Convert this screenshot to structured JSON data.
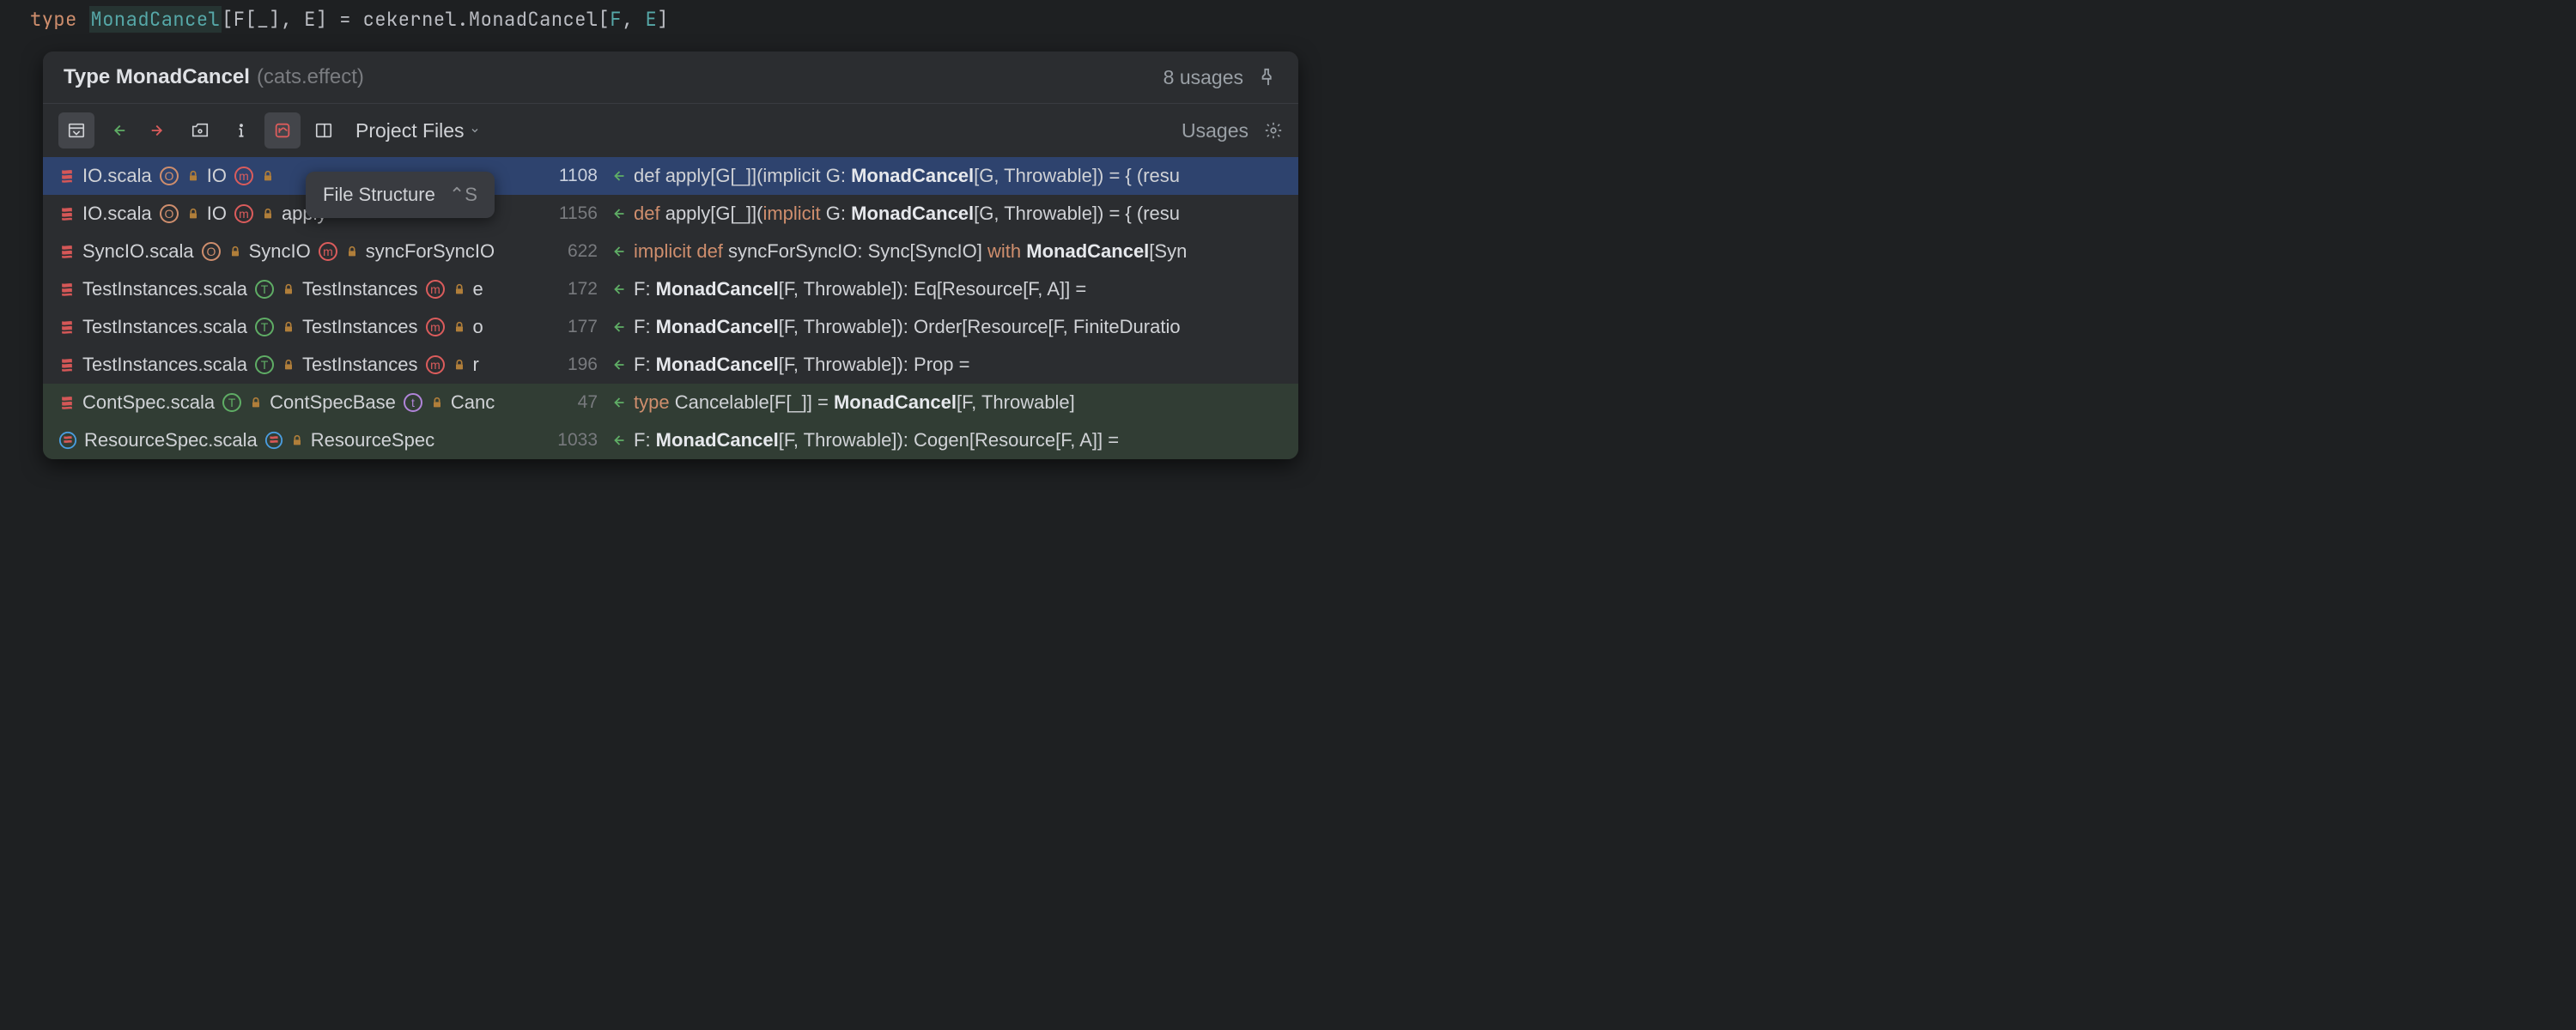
{
  "code": {
    "keyword": "type",
    "name": "MonadCancel",
    "sig1": "[F[_], E] = cekernel.MonadCancel[",
    "f": "F",
    "comma": ", ",
    "e": "E",
    "end": "]"
  },
  "popup": {
    "title": "Type MonadCancel",
    "subtitle": "(cats.effect)",
    "usages_count": "8 usages"
  },
  "toolbar": {
    "scope": "Project Files",
    "usages_label": "Usages"
  },
  "tooltip": {
    "label": "File Structure",
    "shortcut": "⌃S"
  },
  "rows": [
    {
      "file": "IO.scala",
      "class_type": "o",
      "class_name": "IO",
      "member_type": "m",
      "member": "",
      "line": "1108",
      "code_pre": "def apply[G[_]](implicit G: ",
      "code_hw": "MonadCancel",
      "code_post": "[G, Throwable]) = { (resu",
      "selected": true
    },
    {
      "file": "IO.scala",
      "class_type": "o",
      "class_name": "IO",
      "member_type": "m",
      "member": "apply",
      "line": "1156",
      "code_pre_kw": "def",
      "code_pre": " apply[G[_]](",
      "code_kw2": "implicit",
      "code_mid": " G: ",
      "code_hw": "MonadCancel",
      "code_post": "[G, Throwable]) = { (resu"
    },
    {
      "file": "SyncIO.scala",
      "class_type": "o",
      "class_name": "SyncIO",
      "member_type": "m",
      "member": "syncForSyncIO",
      "line": "622",
      "code_pre_kw": "implicit def",
      "code_pre": " syncForSyncIO: Sync[SyncIO] ",
      "code_kw2": "with",
      "code_mid": " ",
      "code_hw": "MonadCancel",
      "code_post": "[Syn"
    },
    {
      "file": "TestInstances.scala",
      "class_type": "t-green",
      "class_name": "TestInstances",
      "member_type": "m",
      "member": "e",
      "line": "172",
      "code_pre": "F: ",
      "code_hw": "MonadCancel",
      "code_post": "[F, Throwable]): Eq[Resource[F, A]] ="
    },
    {
      "file": "TestInstances.scala",
      "class_type": "t-green",
      "class_name": "TestInstances",
      "member_type": "m",
      "member": "o",
      "line": "177",
      "code_pre": "F: ",
      "code_hw": "MonadCancel",
      "code_post": "[F, Throwable]): Order[Resource[F, FiniteDuratio"
    },
    {
      "file": "TestInstances.scala",
      "class_type": "t-green",
      "class_name": "TestInstances",
      "member_type": "m",
      "member": "r",
      "line": "196",
      "code_pre": "F: ",
      "code_hw": "MonadCancel",
      "code_post": "[F, Throwable]): Prop ="
    },
    {
      "file": "ContSpec.scala",
      "class_type": "t-green",
      "class_name": "ContSpecBase",
      "member_type": "t-purple",
      "member": "Canc",
      "line": "47",
      "code_pre_kw": "type",
      "code_pre": " Cancelable[F[_]] = ",
      "code_hw": "MonadCancel",
      "code_post": "[F, Throwable]",
      "green": true
    },
    {
      "file": "ResourceSpec.scala",
      "class_type": "c-blue",
      "class_name": "ResourceSpec",
      "member_type": "",
      "member": "",
      "line": "1033",
      "code_pre": "F: ",
      "code_hw": "MonadCancel",
      "code_post": "[F, Throwable]): Cogen[Resource[F, A]] =",
      "green": true
    }
  ]
}
